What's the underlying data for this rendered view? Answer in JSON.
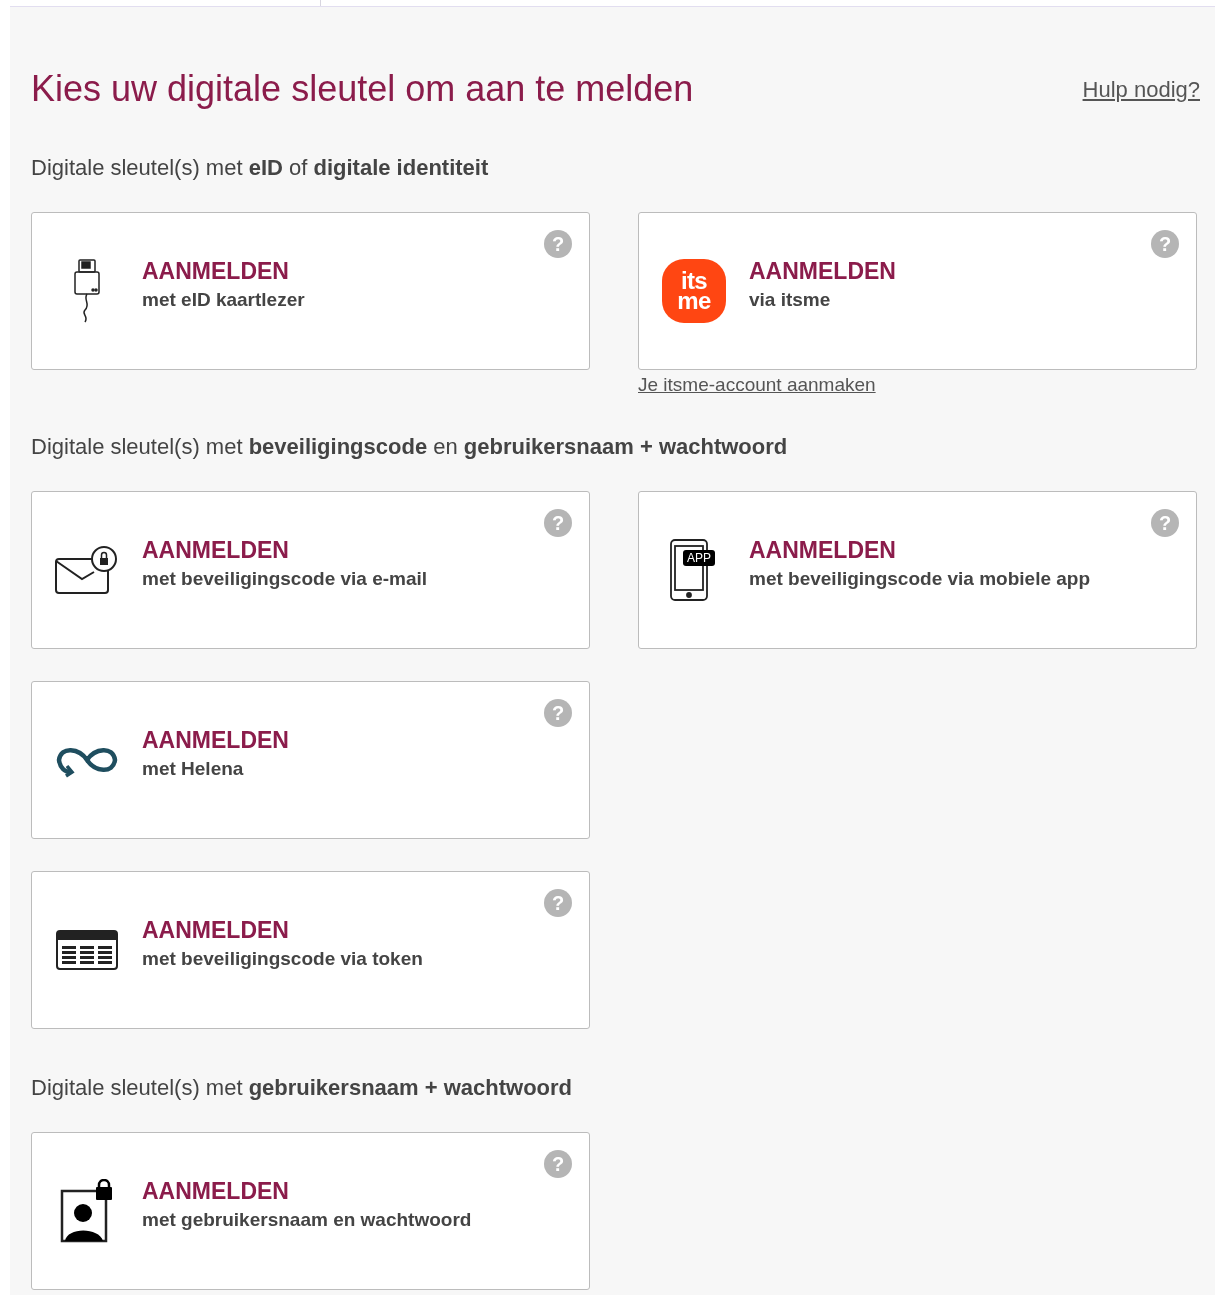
{
  "title": "Kies uw digitale sleutel om aan te melden",
  "help_link": "Hulp nodig?",
  "sections": [
    {
      "heading": "Digitale sleutel(s) met **eID** of **digitale identiteit**",
      "rows": [
        [
          {
            "kind": "eid",
            "title": "AANMELDEN",
            "subtitle": "met eID kaartlezer",
            "help": "?"
          },
          {
            "kind": "itsme",
            "title": "AANMELDEN",
            "subtitle": "via itsme",
            "help": "?",
            "logo_text": [
              "its",
              "me"
            ],
            "link": "Je itsme-account aanmaken"
          }
        ]
      ]
    },
    {
      "heading": "Digitale sleutel(s) met **beveiligingscode** en **gebruikersnaam + wachtwoord**",
      "rows": [
        [
          {
            "kind": "email",
            "title": "AANMELDEN",
            "subtitle": "met beveiligingscode via e-mail",
            "help": "?"
          },
          {
            "kind": "app",
            "title": "AANMELDEN",
            "subtitle": "met beveiligingscode via mobiele app",
            "help": "?",
            "icon_text": "APP"
          }
        ],
        [
          {
            "kind": "helena",
            "title": "AANMELDEN",
            "subtitle": "met Helena",
            "help": "?"
          }
        ],
        [
          {
            "kind": "token",
            "title": "AANMELDEN",
            "subtitle": "met beveiligingscode via token",
            "help": "?"
          }
        ]
      ]
    },
    {
      "heading": "Digitale sleutel(s) met **gebruikersnaam + wachtwoord**",
      "rows": [
        [
          {
            "kind": "password",
            "title": "AANMELDEN",
            "subtitle": "met gebruikersnaam en wachtwoord",
            "help": "?"
          }
        ]
      ]
    }
  ]
}
